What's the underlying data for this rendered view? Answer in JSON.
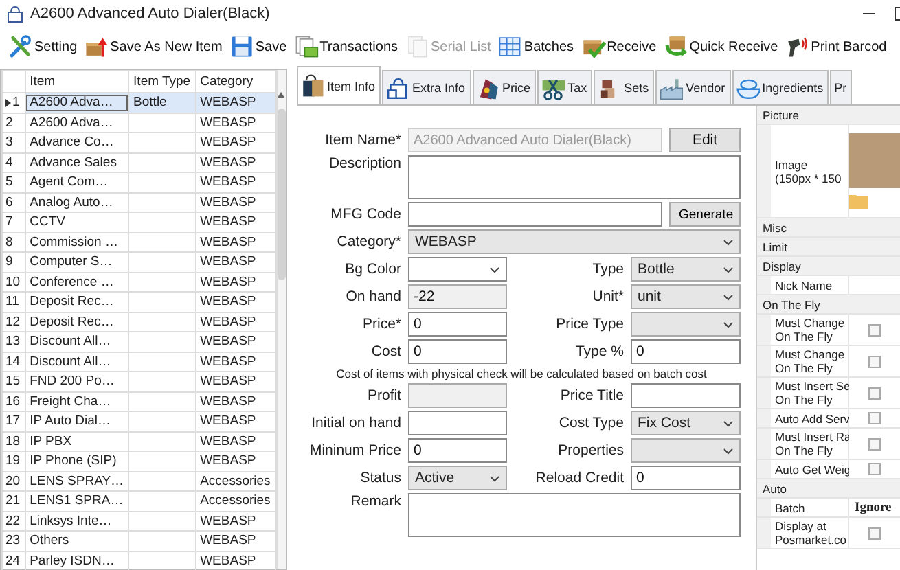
{
  "window": {
    "title": "A2600 Advanced Auto Dialer(Black)"
  },
  "toolbar": [
    {
      "label": "Setting",
      "disabled": false
    },
    {
      "label": "Save As New Item",
      "disabled": false
    },
    {
      "label": "Save",
      "disabled": false
    },
    {
      "label": "Transactions",
      "disabled": false
    },
    {
      "label": "Serial List",
      "disabled": true
    },
    {
      "label": "Batches",
      "disabled": false
    },
    {
      "label": "Receive",
      "disabled": false
    },
    {
      "label": "Quick Receive",
      "disabled": false
    },
    {
      "label": "Print Barcod",
      "disabled": false
    }
  ],
  "grid": {
    "columns": [
      "Item",
      "Item Type",
      "Category"
    ],
    "rows": [
      {
        "number": "1",
        "item": "A2600 Adva…",
        "type": "Bottle",
        "category": "WEBASP",
        "selected": true
      },
      {
        "number": "2",
        "item": "A2600 Adva…",
        "category": "WEBASP",
        "selected": false
      },
      {
        "number": "3",
        "item": "Advance Co…",
        "category": "WEBASP",
        "selected": false
      },
      {
        "number": "4",
        "item": "Advance Sales",
        "category": "WEBASP",
        "selected": false
      },
      {
        "number": "5",
        "item": "Agent Com…",
        "category": "WEBASP",
        "selected": false
      },
      {
        "number": "6",
        "item": "Analog Auto…",
        "category": "WEBASP",
        "selected": false
      },
      {
        "number": "7",
        "item": "CCTV",
        "category": "WEBASP",
        "selected": false
      },
      {
        "number": "8",
        "item": "Commission …",
        "category": "WEBASP",
        "selected": false
      },
      {
        "number": "9",
        "item": "Computer S…",
        "category": "WEBASP",
        "selected": false
      },
      {
        "number": "10",
        "item": "Conference …",
        "category": "WEBASP",
        "selected": false
      },
      {
        "number": "11",
        "item": "Deposit Rec…",
        "category": "WEBASP",
        "selected": false
      },
      {
        "number": "12",
        "item": "Deposit Rec…",
        "category": "WEBASP",
        "selected": false
      },
      {
        "number": "13",
        "item": "Discount All…",
        "category": "WEBASP",
        "selected": false
      },
      {
        "number": "14",
        "item": "Discount All…",
        "category": "WEBASP",
        "selected": false
      },
      {
        "number": "15",
        "item": "FND 200 Po…",
        "category": "WEBASP",
        "selected": false
      },
      {
        "number": "16",
        "item": "Freight Cha…",
        "category": "WEBASP",
        "selected": false
      },
      {
        "number": "17",
        "item": "IP Auto Dial…",
        "category": "WEBASP",
        "selected": false
      },
      {
        "number": "18",
        "item": "IP PBX",
        "category": "WEBASP",
        "selected": false
      },
      {
        "number": "19",
        "item": "IP Phone (SIP)",
        "category": "WEBASP",
        "selected": false
      },
      {
        "number": "20",
        "item": "LENS SPRAY…",
        "category": "Accessories",
        "selected": false
      },
      {
        "number": "21",
        "item": "LENS1 SPRA…",
        "category": "Accessories",
        "selected": false
      },
      {
        "number": "22",
        "item": "Linksys Inte…",
        "category": "WEBASP",
        "selected": false
      },
      {
        "number": "23",
        "item": "Others",
        "category": "WEBASP",
        "selected": false
      },
      {
        "number": "24",
        "item": "Parley ISDN…",
        "category": "WEBASP",
        "selected": false
      }
    ]
  },
  "tabs": [
    {
      "label": "Item Info",
      "selected": true
    },
    {
      "label": "Extra Info",
      "selected": false
    },
    {
      "label": "Price",
      "selected": false
    },
    {
      "label": "Tax",
      "selected": false
    },
    {
      "label": "Sets",
      "selected": false
    },
    {
      "label": "Vendor",
      "selected": false
    },
    {
      "label": "Ingredients",
      "selected": false
    },
    {
      "label": "Pr",
      "selected": false
    }
  ],
  "form": {
    "item_name": {
      "label": "Item Name*",
      "value": "A2600 Advanced Auto Dialer(Black)",
      "disabled": true,
      "button": "Edit"
    },
    "description": {
      "label": "Description"
    },
    "mfg_code": {
      "label": "MFG Code",
      "button": "Generate"
    },
    "category": {
      "label": "Category*",
      "value": "WEBASP"
    },
    "rows": [
      {
        "kind": "pair",
        "left": {
          "label": "Bg Color",
          "kind": "combo"
        },
        "right": {
          "label": "Type",
          "kind": "dropdown",
          "value": "Bottle"
        }
      },
      {
        "kind": "pair",
        "left": {
          "label": "On hand",
          "kind": "readonly",
          "value": "-22"
        },
        "right": {
          "label": "Unit*",
          "kind": "dropdown",
          "value": "unit"
        }
      },
      {
        "kind": "pair",
        "left": {
          "label": "Price*",
          "kind": "text",
          "value": "0"
        },
        "right": {
          "label": "Price Type",
          "kind": "dropdown"
        }
      },
      {
        "kind": "pair",
        "left": {
          "label": "Cost",
          "kind": "text",
          "value": "0"
        },
        "right": {
          "label": "Type %",
          "kind": "text",
          "value": "0"
        }
      },
      {
        "kind": "note",
        "text": "Cost of items with physical check will be calculated based on batch cost"
      },
      {
        "kind": "pair",
        "left": {
          "label": "Profit",
          "kind": "readonly"
        },
        "right": {
          "label": "Price Title",
          "kind": "text"
        }
      },
      {
        "kind": "pair",
        "left": {
          "label": "Initial on hand",
          "kind": "text"
        },
        "right": {
          "label": "Cost Type",
          "kind": "dropdown",
          "value": "Fix Cost"
        }
      },
      {
        "kind": "pair",
        "left": {
          "label": "Mininum Price",
          "kind": "text",
          "value": "0"
        },
        "right": {
          "label": "Properties",
          "kind": "dropdown"
        }
      },
      {
        "kind": "pair",
        "left": {
          "label": "Status",
          "kind": "dropdown",
          "value": "Active"
        },
        "right": {
          "label": "Reload Credit",
          "kind": "text",
          "value": "0"
        }
      }
    ],
    "remark": {
      "label": "Remark"
    }
  },
  "properties": [
    {
      "category": "Picture",
      "rows": [
        {
          "kind": "image",
          "name": "Image\n(150px * 150"
        }
      ]
    },
    {
      "category": "Misc"
    },
    {
      "category": "Limit"
    },
    {
      "category": "Display",
      "rows": [
        {
          "kind": "text",
          "name": "Nick Name"
        }
      ]
    },
    {
      "category": "On The Fly",
      "rows": [
        {
          "kind": "checkbox",
          "name": "Must Change\nOn The Fly",
          "checked": false
        },
        {
          "kind": "checkbox",
          "name": "Must Change\nOn The Fly",
          "checked": false
        },
        {
          "kind": "checkbox",
          "name": "Must Insert Se\nOn The Fly",
          "checked": false
        },
        {
          "kind": "checkbox",
          "name": "Auto Add Serv",
          "checked": false
        },
        {
          "kind": "checkbox",
          "name": "Must Insert Ra\nOn The Fly",
          "checked": false
        },
        {
          "kind": "checkbox",
          "name": "Auto Get Weig",
          "checked": false
        }
      ]
    },
    {
      "category": "Auto",
      "rows": [
        {
          "kind": "text",
          "name": "Batch",
          "value": "Ignore"
        },
        {
          "kind": "checkbox",
          "name": "Display at\nPosmarket.co",
          "checked": false
        }
      ]
    }
  ]
}
